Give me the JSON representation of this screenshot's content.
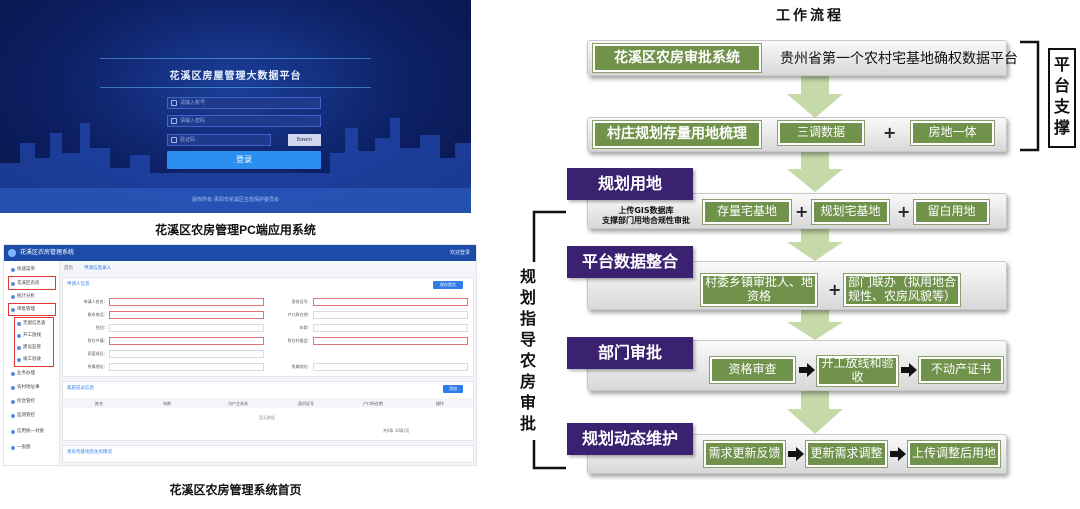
{
  "login_screenshot": {
    "title": "花溪区房屋管理大数据平台",
    "username_placeholder": "请输入账号",
    "password_placeholder": "请输入密码",
    "captcha_placeholder": "验证码",
    "captcha_value": "6owm",
    "login_button": "登录",
    "copyright": "版权所有:贵阳市花溪区生态保护委员会"
  },
  "caption_login": "花溪区农房管理PC端应用系统",
  "pc_screenshot": {
    "app_title": "花溪区农房管理系统",
    "top_right": "欢迎登录",
    "breadcrumb": [
      "首页",
      "申请信息录入"
    ],
    "sidebar": [
      "快速菜单",
      "花溪区农房",
      "统计分析",
      "审批管理",
      "无偿信息查",
      "开工放线",
      "建设监管",
      "竣工验收",
      "业务办理",
      "农村地址事",
      "综合管控",
      "监测管控",
      "信用统一对接",
      "一张图"
    ],
    "section_title": "申请人信息",
    "save_button": "保存提交",
    "form_labels": [
      "申请人姓名:",
      "身份证号:",
      "联系电话:",
      "户口所在地:",
      "性别:",
      "年龄:",
      "所在乡镇:",
      "所在村委会:",
      "家庭成员:",
      "所属地址:",
      "所属地址:"
    ],
    "table_section": "家庭成员信息",
    "add_button": "添加",
    "table_headers": [
      "姓名",
      "年龄",
      "与户主关系",
      "身份证号",
      "户口所在地",
      "操作"
    ],
    "no_data": "暂无数据",
    "pagination": "共0条 10条/页",
    "next_section": "现有宅基地及住房情况"
  },
  "caption_pc": "花溪区农房管理系统首页",
  "workflow": {
    "title": "工作流程",
    "row1": {
      "label": "花溪区农房审批系统",
      "text": "贵州省第一个农村宅基地确权数据平台"
    },
    "row2": {
      "label": "村庄规划存量用地梳理",
      "box1": "三调数据",
      "plus": "+",
      "box2": "房地一体"
    },
    "row3": {
      "tag": "规划用地",
      "note_line1": "上传GIS数据库",
      "note_line2": "支撑部门用地合规性审批",
      "box1": "存量宅基地",
      "plus1": "+",
      "box2": "规划宅基地",
      "plus2": "+",
      "box3": "留白用地"
    },
    "row4": {
      "tag": "平台数据整合",
      "box1": "村委乡镇审批人、地资格",
      "plus": "+",
      "box2": "部门联办（拟用地合规性、农房风貌等）"
    },
    "row5": {
      "tag": "部门审批",
      "box1": "资格审查",
      "box2": "开工放线和验收",
      "box3": "不动产证书"
    },
    "row6": {
      "tag": "规划动态维护",
      "box1": "需求更新反馈",
      "box2": "更新需求调整",
      "box3": "上传调整后用地"
    },
    "platform_support": "平台支撑",
    "planning_guide": "规划指导农房审批"
  }
}
